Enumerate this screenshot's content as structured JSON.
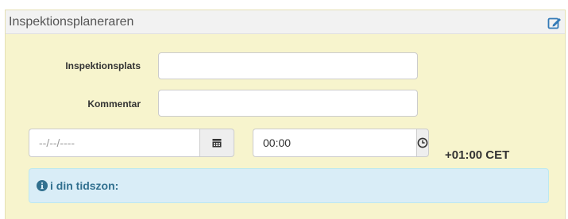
{
  "panel": {
    "title": "Inspektionsplaneraren",
    "edit_icon": "edit-icon",
    "accent_color": "#337ab7"
  },
  "form": {
    "location_label": "Inspektionsplats",
    "location_value": "",
    "comment_label": "Kommentar",
    "comment_value": "",
    "date_placeholder": "--/--/----",
    "date_icon": "calendar-icon",
    "time_value": "00:00",
    "time_icon": "clock-icon",
    "timezone": "+01:00 CET"
  },
  "alert": {
    "icon": "info-circle-icon",
    "text": "i din tidszon:"
  }
}
